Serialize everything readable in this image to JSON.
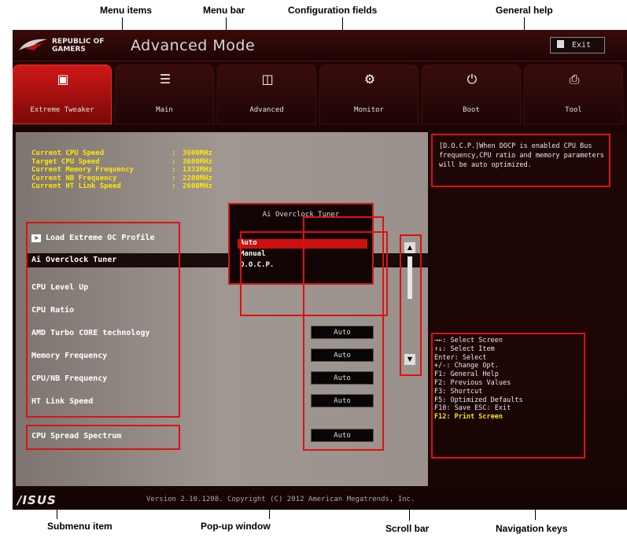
{
  "callouts": {
    "menu_items": "Menu items",
    "menu_bar": "Menu bar",
    "configuration_fields": "Configuration fields",
    "general_help": "General help",
    "submenu_item": "Submenu item",
    "popup_window": "Pop-up window",
    "scroll_bar": "Scroll bar",
    "navigation_keys": "Navigation keys"
  },
  "header": {
    "brand_line1": "REPUBLIC OF",
    "brand_line2": "GAMERS",
    "mode_title": "Advanced Mode",
    "exit_label": "Exit"
  },
  "tabs": [
    {
      "label": "Extreme Tweaker",
      "icon": "extreme-tweaker-icon"
    },
    {
      "label": "Main",
      "icon": "main-list-icon"
    },
    {
      "label": "Advanced",
      "icon": "advanced-icon"
    },
    {
      "label": "Monitor",
      "icon": "monitor-icon"
    },
    {
      "label": "Boot",
      "icon": "power-icon"
    },
    {
      "label": "Tool",
      "icon": "tool-icon"
    }
  ],
  "info": [
    {
      "label": "Current CPU Speed",
      "value": "3600MHz"
    },
    {
      "label": "Target CPU Speed",
      "value": "3600MHz"
    },
    {
      "label": "Current Memory Frequency",
      "value": "1333MHz"
    },
    {
      "label": "Current NB Frequency",
      "value": "2200MHz"
    },
    {
      "label": "Current HT Link Speed",
      "value": "2600MHz"
    }
  ],
  "menu_items": [
    {
      "label": "Load Extreme OC Profile"
    },
    {
      "label": "Ai Overclock Tuner"
    },
    {
      "label": "CPU Level Up"
    },
    {
      "label": "CPU Ratio"
    },
    {
      "label": "AMD Turbo CORE technology",
      "value": "Auto"
    },
    {
      "label": "Memory Frequency",
      "value": "Auto"
    },
    {
      "label": "CPU/NB Frequency",
      "value": "Auto"
    },
    {
      "label": "HT Link Speed",
      "value": "Auto"
    },
    {
      "label": "CPU Spread Spectrum",
      "value": "Auto"
    }
  ],
  "popup": {
    "title": "Ai Overclock Tuner",
    "options": [
      "Auto",
      "Manual",
      "D.O.C.P."
    ],
    "selected": "Auto"
  },
  "help": {
    "text": "[D.O.C.P.]When DOCP is enabled CPU Bus frequency,CPU ratio and memory parameters will be auto optimized."
  },
  "nav_keys": [
    "→←: Select Screen",
    "↑↓: Select Item",
    "Enter: Select",
    "+/-: Change Opt.",
    "F1: General Help",
    "F2: Previous Values",
    "F3: Shortcut",
    "F5: Optimized Defaults",
    "F10: Save  ESC: Exit",
    "F12: Print Screen"
  ],
  "footer": {
    "logo": "/ISUS",
    "version": "Version 2.10.1208. Copyright (C) 2012 American Megatrends, Inc."
  },
  "colors": {
    "accent": "#cc1010",
    "highlight_text": "#ffe600",
    "callout_box": "#e01010"
  }
}
